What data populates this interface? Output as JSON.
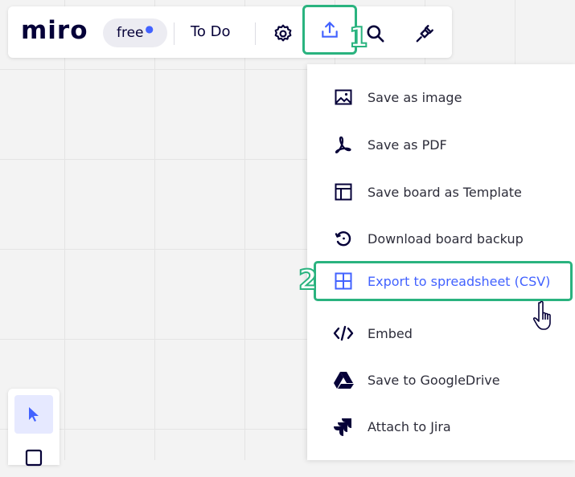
{
  "app": {
    "logo": "miro",
    "plan_badge": "free",
    "board_name": "To Do"
  },
  "toolbar": {
    "buttons": [
      {
        "name": "settings",
        "icon": "gear-icon"
      },
      {
        "name": "share-export",
        "icon": "upload-icon"
      },
      {
        "name": "search",
        "icon": "search-icon"
      },
      {
        "name": "plugins",
        "icon": "plug-icon"
      }
    ]
  },
  "annotations": {
    "step1": "1",
    "step2": "2"
  },
  "menu": {
    "items": [
      {
        "label": "Save as image",
        "icon": "image-icon"
      },
      {
        "label": "Save as PDF",
        "icon": "pdf-icon"
      },
      {
        "label": "Save board as Template",
        "icon": "template-icon"
      },
      {
        "label": "Download board backup",
        "icon": "backup-icon"
      },
      {
        "label": "Export to spreadsheet (CSV)",
        "icon": "grid-icon",
        "highlighted": true
      },
      {
        "label": "Embed",
        "icon": "code-icon"
      },
      {
        "label": "Save to GoogleDrive",
        "icon": "google-drive-icon"
      },
      {
        "label": "Attach to Jira",
        "icon": "jira-icon"
      }
    ]
  },
  "left_toolbar": {
    "tools": [
      {
        "name": "select",
        "icon": "pointer-icon",
        "active": true
      },
      {
        "name": "frame",
        "icon": "frame-icon",
        "active": false
      }
    ]
  },
  "colors": {
    "highlight": "#2ab37f",
    "accent": "#4262ff",
    "text": "#050038"
  }
}
